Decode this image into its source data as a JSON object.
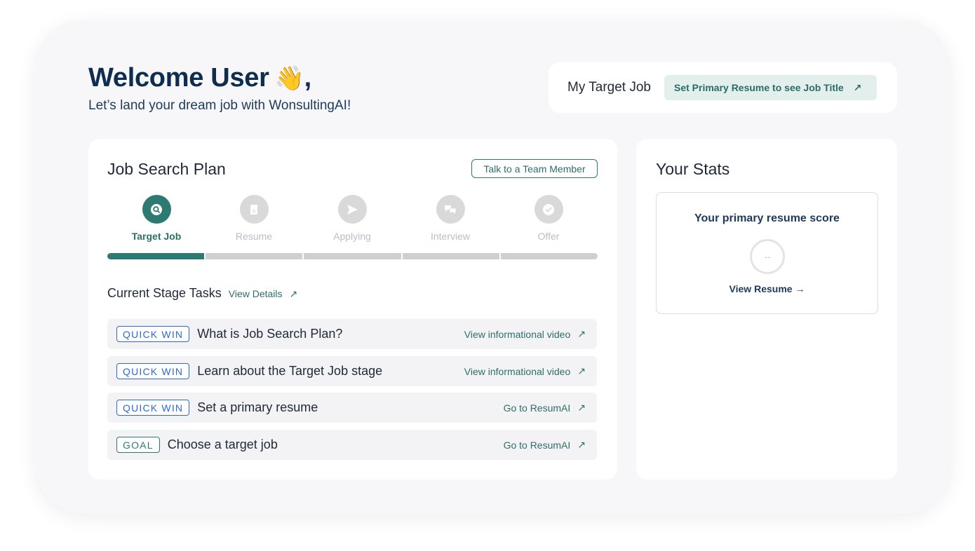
{
  "header": {
    "title": "Welcome User",
    "title_suffix": ",",
    "subtitle": "Let’s land your dream job with WonsultingAI!"
  },
  "target_job": {
    "label": "My Target Job",
    "pill_text": "Set Primary Resume to see Job Title",
    "arrow": "↗"
  },
  "plan": {
    "title": "Job Search Plan",
    "talk_button": "Talk to a Team Member",
    "stages": [
      {
        "label": "Target Job",
        "icon": "search-icon",
        "active": true
      },
      {
        "label": "Resume",
        "icon": "document-icon",
        "active": false
      },
      {
        "label": "Applying",
        "icon": "send-icon",
        "active": false
      },
      {
        "label": "Interview",
        "icon": "chat-icon",
        "active": false
      },
      {
        "label": "Offer",
        "icon": "check-icon",
        "active": false
      }
    ],
    "progress_completed_segments": 1,
    "progress_total_segments": 5,
    "tasks_heading": "Current Stage Tasks",
    "view_details": "View Details",
    "tasks": [
      {
        "badge": "QUICK WIN",
        "title": "What is Job Search Plan?",
        "link": "View informational video"
      },
      {
        "badge": "QUICK WIN",
        "title": "Learn about the Target Job stage",
        "link": "View informational video"
      },
      {
        "badge": "QUICK WIN",
        "title": "Set a primary resume",
        "link": "Go to ResumAI"
      },
      {
        "badge": "GOAL",
        "title": "Choose a target job",
        "link": "Go to ResumAI"
      }
    ]
  },
  "stats": {
    "title": "Your Stats",
    "score_label": "Your primary resume score",
    "score_value": "--",
    "view_resume": "View Resume →"
  },
  "colors": {
    "brand_teal": "#2d7a73",
    "navy": "#0f2d4f",
    "quick_win_blue": "#2d69d6"
  }
}
